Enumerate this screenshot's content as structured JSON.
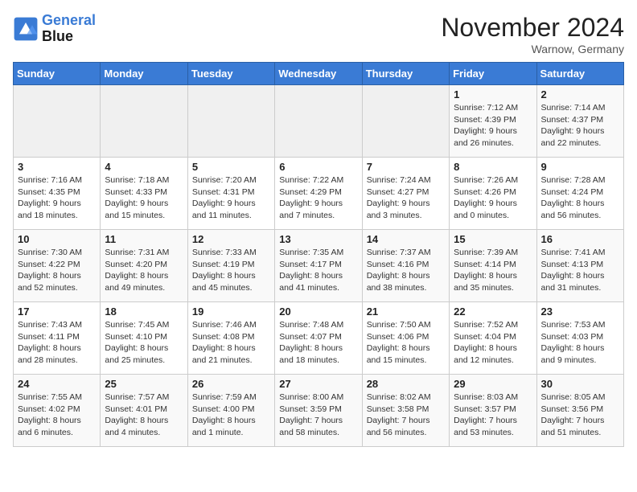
{
  "logo": {
    "line1": "General",
    "line2": "Blue"
  },
  "title": "November 2024",
  "location": "Warnow, Germany",
  "days_of_week": [
    "Sunday",
    "Monday",
    "Tuesday",
    "Wednesday",
    "Thursday",
    "Friday",
    "Saturday"
  ],
  "weeks": [
    [
      {
        "day": "",
        "info": ""
      },
      {
        "day": "",
        "info": ""
      },
      {
        "day": "",
        "info": ""
      },
      {
        "day": "",
        "info": ""
      },
      {
        "day": "",
        "info": ""
      },
      {
        "day": "1",
        "info": "Sunrise: 7:12 AM\nSunset: 4:39 PM\nDaylight: 9 hours\nand 26 minutes."
      },
      {
        "day": "2",
        "info": "Sunrise: 7:14 AM\nSunset: 4:37 PM\nDaylight: 9 hours\nand 22 minutes."
      }
    ],
    [
      {
        "day": "3",
        "info": "Sunrise: 7:16 AM\nSunset: 4:35 PM\nDaylight: 9 hours\nand 18 minutes."
      },
      {
        "day": "4",
        "info": "Sunrise: 7:18 AM\nSunset: 4:33 PM\nDaylight: 9 hours\nand 15 minutes."
      },
      {
        "day": "5",
        "info": "Sunrise: 7:20 AM\nSunset: 4:31 PM\nDaylight: 9 hours\nand 11 minutes."
      },
      {
        "day": "6",
        "info": "Sunrise: 7:22 AM\nSunset: 4:29 PM\nDaylight: 9 hours\nand 7 minutes."
      },
      {
        "day": "7",
        "info": "Sunrise: 7:24 AM\nSunset: 4:27 PM\nDaylight: 9 hours\nand 3 minutes."
      },
      {
        "day": "8",
        "info": "Sunrise: 7:26 AM\nSunset: 4:26 PM\nDaylight: 9 hours\nand 0 minutes."
      },
      {
        "day": "9",
        "info": "Sunrise: 7:28 AM\nSunset: 4:24 PM\nDaylight: 8 hours\nand 56 minutes."
      }
    ],
    [
      {
        "day": "10",
        "info": "Sunrise: 7:30 AM\nSunset: 4:22 PM\nDaylight: 8 hours\nand 52 minutes."
      },
      {
        "day": "11",
        "info": "Sunrise: 7:31 AM\nSunset: 4:20 PM\nDaylight: 8 hours\nand 49 minutes."
      },
      {
        "day": "12",
        "info": "Sunrise: 7:33 AM\nSunset: 4:19 PM\nDaylight: 8 hours\nand 45 minutes."
      },
      {
        "day": "13",
        "info": "Sunrise: 7:35 AM\nSunset: 4:17 PM\nDaylight: 8 hours\nand 41 minutes."
      },
      {
        "day": "14",
        "info": "Sunrise: 7:37 AM\nSunset: 4:16 PM\nDaylight: 8 hours\nand 38 minutes."
      },
      {
        "day": "15",
        "info": "Sunrise: 7:39 AM\nSunset: 4:14 PM\nDaylight: 8 hours\nand 35 minutes."
      },
      {
        "day": "16",
        "info": "Sunrise: 7:41 AM\nSunset: 4:13 PM\nDaylight: 8 hours\nand 31 minutes."
      }
    ],
    [
      {
        "day": "17",
        "info": "Sunrise: 7:43 AM\nSunset: 4:11 PM\nDaylight: 8 hours\nand 28 minutes."
      },
      {
        "day": "18",
        "info": "Sunrise: 7:45 AM\nSunset: 4:10 PM\nDaylight: 8 hours\nand 25 minutes."
      },
      {
        "day": "19",
        "info": "Sunrise: 7:46 AM\nSunset: 4:08 PM\nDaylight: 8 hours\nand 21 minutes."
      },
      {
        "day": "20",
        "info": "Sunrise: 7:48 AM\nSunset: 4:07 PM\nDaylight: 8 hours\nand 18 minutes."
      },
      {
        "day": "21",
        "info": "Sunrise: 7:50 AM\nSunset: 4:06 PM\nDaylight: 8 hours\nand 15 minutes."
      },
      {
        "day": "22",
        "info": "Sunrise: 7:52 AM\nSunset: 4:04 PM\nDaylight: 8 hours\nand 12 minutes."
      },
      {
        "day": "23",
        "info": "Sunrise: 7:53 AM\nSunset: 4:03 PM\nDaylight: 8 hours\nand 9 minutes."
      }
    ],
    [
      {
        "day": "24",
        "info": "Sunrise: 7:55 AM\nSunset: 4:02 PM\nDaylight: 8 hours\nand 6 minutes."
      },
      {
        "day": "25",
        "info": "Sunrise: 7:57 AM\nSunset: 4:01 PM\nDaylight: 8 hours\nand 4 minutes."
      },
      {
        "day": "26",
        "info": "Sunrise: 7:59 AM\nSunset: 4:00 PM\nDaylight: 8 hours\nand 1 minute."
      },
      {
        "day": "27",
        "info": "Sunrise: 8:00 AM\nSunset: 3:59 PM\nDaylight: 7 hours\nand 58 minutes."
      },
      {
        "day": "28",
        "info": "Sunrise: 8:02 AM\nSunset: 3:58 PM\nDaylight: 7 hours\nand 56 minutes."
      },
      {
        "day": "29",
        "info": "Sunrise: 8:03 AM\nSunset: 3:57 PM\nDaylight: 7 hours\nand 53 minutes."
      },
      {
        "day": "30",
        "info": "Sunrise: 8:05 AM\nSunset: 3:56 PM\nDaylight: 7 hours\nand 51 minutes."
      }
    ]
  ]
}
